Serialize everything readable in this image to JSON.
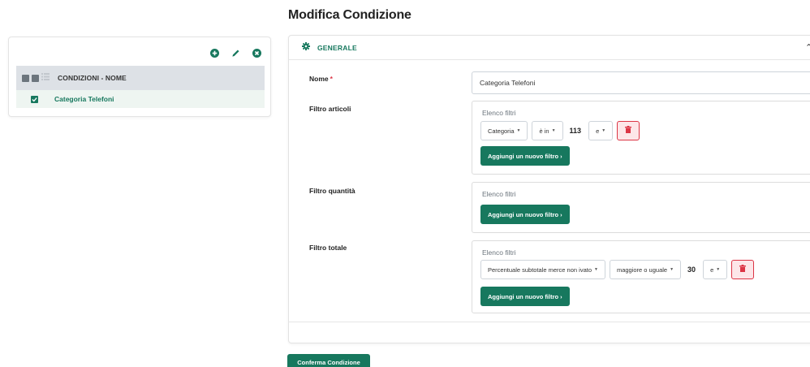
{
  "page": {
    "title": "Modifica Condizione"
  },
  "sidebar": {
    "toolbar": {
      "icons": [
        "plus-circle-icon",
        "pencil-icon",
        "close-circle-icon"
      ]
    },
    "header_label": "CONDIZIONI - NOME",
    "rows": [
      {
        "label": "Categoria Telefoni",
        "checked": true
      }
    ]
  },
  "section": {
    "title": "GENERALE",
    "icon": "gear-icon",
    "collapse_icon": "chevron-up-icon"
  },
  "fields": {
    "nome": {
      "label": "Nome",
      "required_mark": "*",
      "value": "Categoria Telefoni"
    },
    "filtro_articoli": {
      "label": "Filtro articoli",
      "list_title": "Elenco filtri",
      "filters": [
        {
          "field": "Categoria",
          "operator": "è in",
          "value": "113",
          "conjunction": "e"
        }
      ],
      "add_label": "Aggiungi un nuovo filtro ›"
    },
    "filtro_quantita": {
      "label": "Filtro quantità",
      "list_title": "Elenco filtri",
      "add_label": "Aggiungi un nuovo filtro ›"
    },
    "filtro_totale": {
      "label": "Filtro totale",
      "list_title": "Elenco filtri",
      "filters": [
        {
          "field": "Percentuale subtotale merce non ivato",
          "operator": "maggiore o uguale",
          "value": "30",
          "conjunction": "e"
        }
      ],
      "add_label": "Aggiungi un nuovo filtro ›"
    }
  },
  "actions": {
    "confirm_label": "Conferma Condizione"
  },
  "colors": {
    "brand": "#17785e",
    "danger": "#dc3545",
    "header_bg": "#dde1e6"
  }
}
